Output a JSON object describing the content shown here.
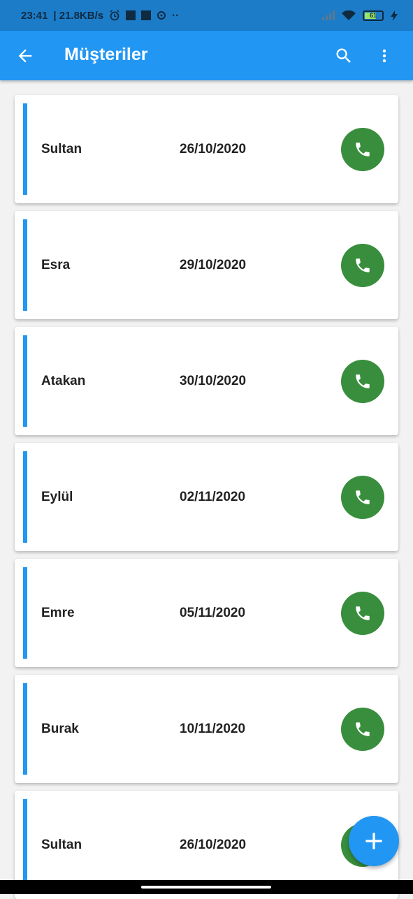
{
  "status_bar": {
    "time": "23:41",
    "speed": "| 21.8KB/s",
    "dots": "··",
    "battery_level": "61"
  },
  "app_bar": {
    "title": "Müşteriler",
    "back_icon": "arrow-back-icon",
    "search_icon": "search-icon",
    "more_icon": "more-vert-icon"
  },
  "customers": [
    {
      "name": "Sultan",
      "date": "26/10/2020"
    },
    {
      "name": "Esra",
      "date": "29/10/2020"
    },
    {
      "name": "Atakan",
      "date": "30/10/2020"
    },
    {
      "name": "Eylül",
      "date": "02/11/2020"
    },
    {
      "name": "Emre",
      "date": "05/11/2020"
    },
    {
      "name": "Burak",
      "date": "10/11/2020"
    },
    {
      "name": "Sultan",
      "date": "26/10/2020"
    }
  ],
  "colors": {
    "primary": "#2196f3",
    "call_button": "#388e3c",
    "status_bar": "#1c7cc8"
  }
}
